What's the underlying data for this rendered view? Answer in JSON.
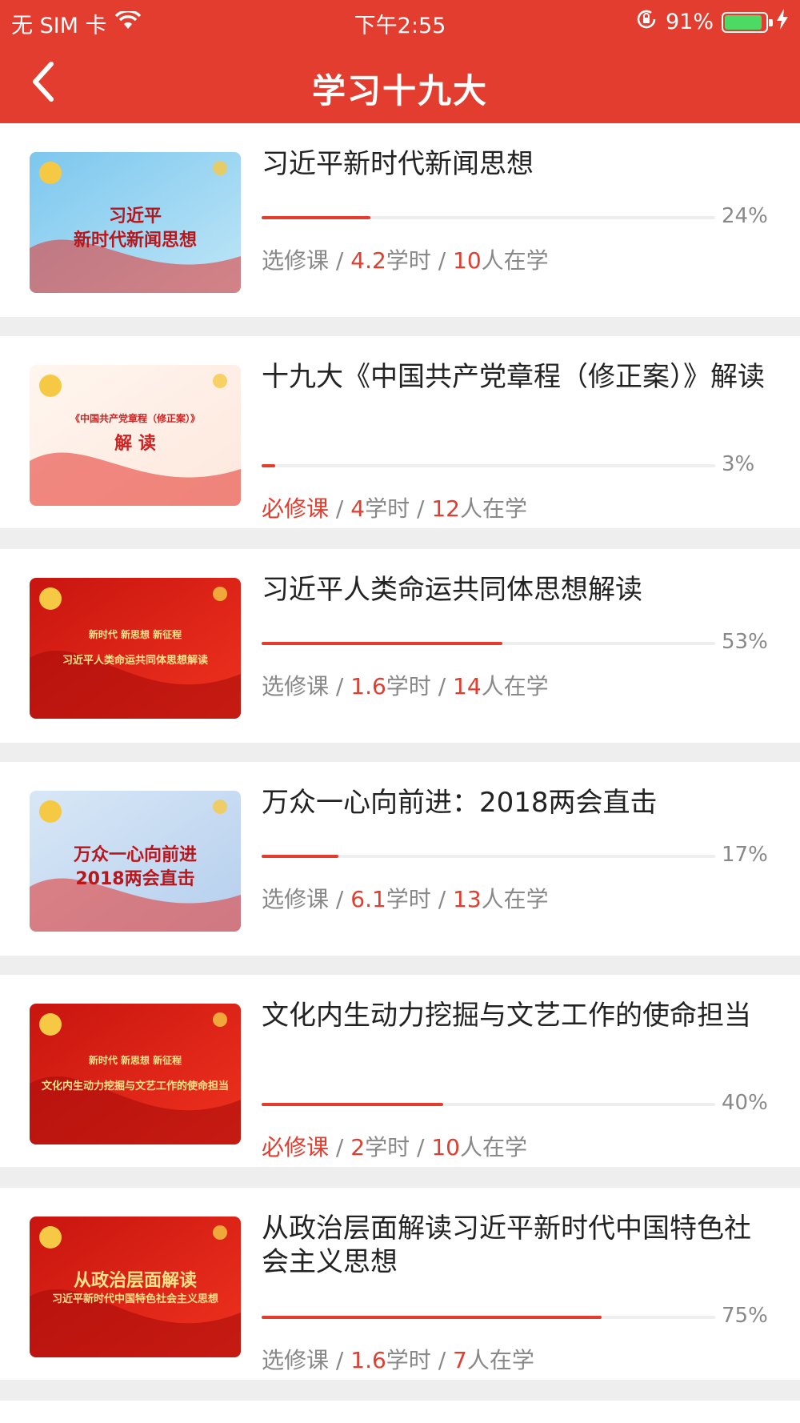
{
  "status_bar": {
    "carrier": "无 SIM 卡",
    "time": "下午2:55",
    "battery": "91%"
  },
  "nav": {
    "title": "学习十九大"
  },
  "labels": {
    "hours_unit": "学时",
    "learners_unit": "人在学",
    "sep": " / "
  },
  "courses": [
    {
      "title": "习近平新时代新闻思想",
      "progress": 0.24,
      "progress_label": "24%",
      "type": "选修课",
      "required": false,
      "hours": "4.2",
      "learners": "10",
      "thumb_text": [
        "习近平",
        "新时代新闻思想"
      ]
    },
    {
      "title": "十九大《中国共产党章程（修正案）》解读",
      "progress": 0.03,
      "progress_label": "3%",
      "type": "必修课",
      "required": true,
      "hours": "4",
      "learners": "12",
      "thumb_text": [
        "《中国共产党章程（修正案）》",
        "解  读"
      ]
    },
    {
      "title": "习近平人类命运共同体思想解读",
      "progress": 0.53,
      "progress_label": "53%",
      "type": "选修课",
      "required": false,
      "hours": "1.6",
      "learners": "14",
      "thumb_text": [
        "新时代 新思想 新征程",
        "习近平人类命运共同体思想解读"
      ]
    },
    {
      "title": "万众一心向前进：2018两会直击",
      "progress": 0.17,
      "progress_label": "17%",
      "type": "选修课",
      "required": false,
      "hours": "6.1",
      "learners": "13",
      "thumb_text": [
        "万众一心向前进",
        "2018两会直击"
      ]
    },
    {
      "title": "文化内生动力挖掘与文艺工作的使命担当",
      "progress": 0.4,
      "progress_label": "40%",
      "type": "必修课",
      "required": true,
      "hours": "2",
      "learners": "10",
      "thumb_text": [
        "新时代 新思想 新征程",
        "文化内生动力挖掘与文艺工作的使命担当"
      ]
    },
    {
      "title": "从政治层面解读习近平新时代中国特色社会主义思想",
      "progress": 0.75,
      "progress_label": "75%",
      "type": "选修课",
      "required": false,
      "hours": "1.6",
      "learners": "7",
      "thumb_text": [
        "从政治层面解读",
        "习近平新时代中国特色社会主义思想"
      ]
    }
  ],
  "colors": {
    "accent": "#e23d2e",
    "muted": "#888888",
    "page_bg": "#eeeeee"
  },
  "icons": {
    "back": "chevron-left-icon",
    "wifi": "wifi-icon",
    "lock": "orientation-lock-icon",
    "charging": "bolt-icon"
  }
}
